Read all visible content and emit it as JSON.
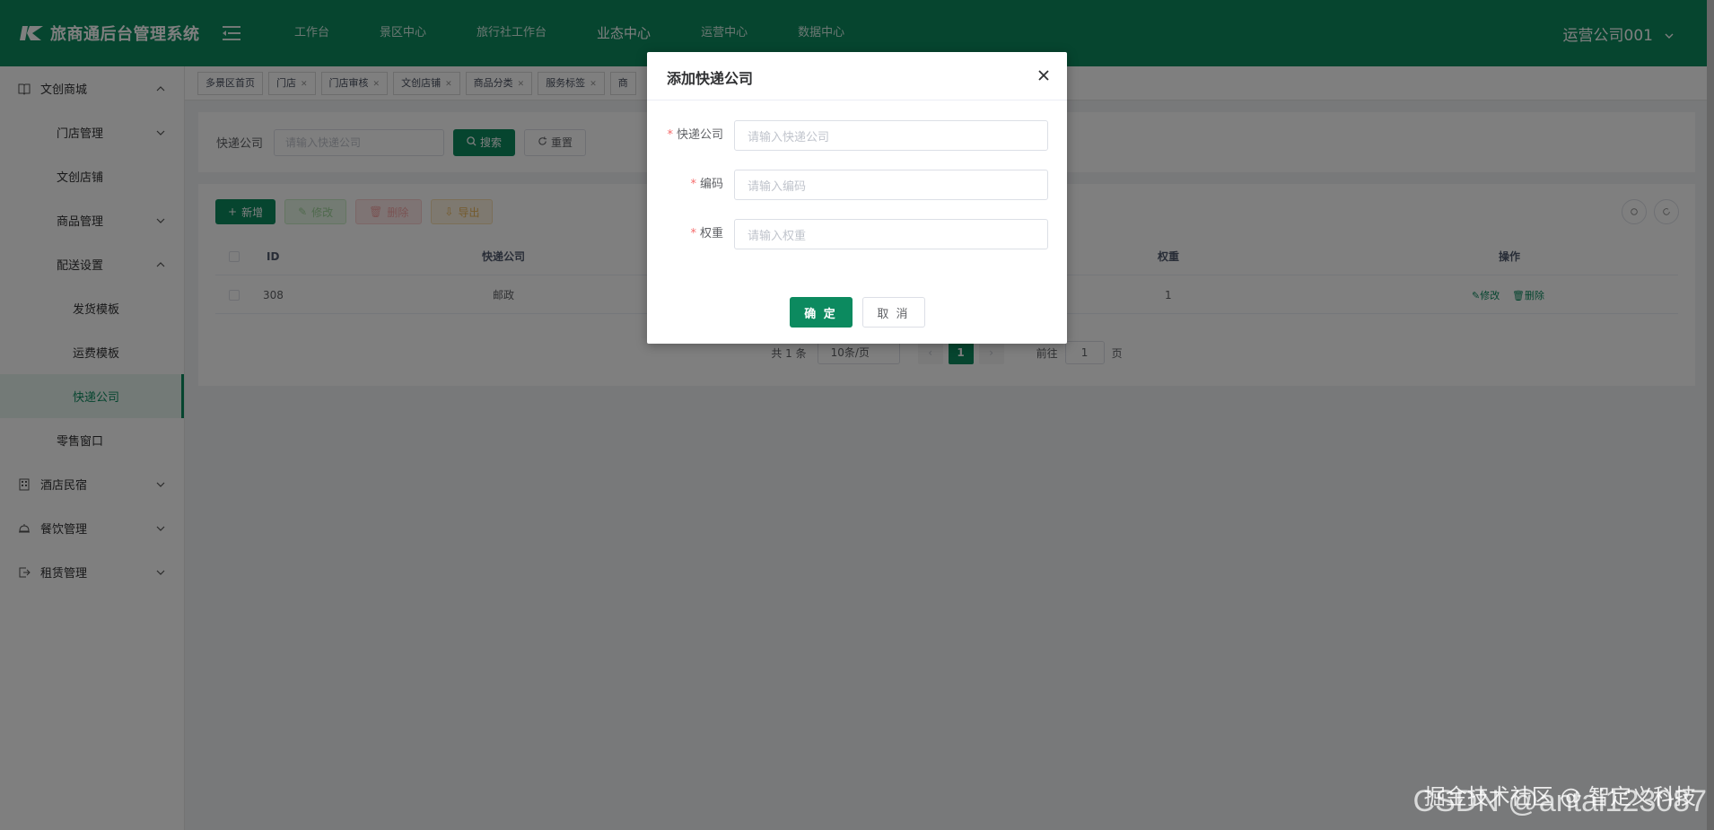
{
  "header": {
    "title": "旅商通后台管理系统",
    "nav": [
      "工作台",
      "景区中心",
      "旅行社工作台",
      "业态中心",
      "运营中心",
      "数据中心"
    ],
    "active_nav": "业态中心",
    "user": "运营公司001"
  },
  "sidebar": {
    "items": [
      {
        "label": "文创商城",
        "icon": "book-icon",
        "level": 1,
        "expanded": true
      },
      {
        "label": "门店管理",
        "level": 2,
        "expandable": true
      },
      {
        "label": "文创店铺",
        "level": 2
      },
      {
        "label": "商品管理",
        "level": 2,
        "expandable": true
      },
      {
        "label": "配送设置",
        "level": 2,
        "expanded": true
      },
      {
        "label": "发货模板",
        "level": 3
      },
      {
        "label": "运费模板",
        "level": 3
      },
      {
        "label": "快递公司",
        "level": 3,
        "active": true
      },
      {
        "label": "零售窗口",
        "level": 2
      },
      {
        "label": "酒店民宿",
        "icon": "building-icon",
        "level": 1,
        "expandable": true
      },
      {
        "label": "餐饮管理",
        "icon": "bell-icon",
        "level": 1,
        "expandable": true
      },
      {
        "label": "租赁管理",
        "icon": "exit-icon",
        "level": 1,
        "expandable": true
      }
    ]
  },
  "tags": [
    "多景区首页",
    "门店",
    "门店审核",
    "文创店铺",
    "商品分类",
    "服务标签",
    "商"
  ],
  "search": {
    "label": "快递公司",
    "placeholder": "请输入快递公司",
    "search_btn": "搜索",
    "reset_btn": "重置"
  },
  "toolbar": {
    "add": "新增",
    "edit": "修改",
    "delete": "删除",
    "export": "导出"
  },
  "table": {
    "headers": [
      "ID",
      "快递公司",
      "权重",
      "操作"
    ],
    "rows": [
      {
        "id": "308",
        "company": "邮政",
        "weight": "1",
        "edit": "修改",
        "delete": "删除"
      }
    ]
  },
  "pager": {
    "total": "共 1 条",
    "size": "10条/页",
    "page": "1",
    "goto_label": "前往",
    "goto_value": "1",
    "page_unit": "页"
  },
  "dialog": {
    "title": "添加快递公司",
    "fields": [
      {
        "label": "快递公司",
        "placeholder": "请输入快递公司"
      },
      {
        "label": "编码",
        "placeholder": "请输入编码"
      },
      {
        "label": "权重",
        "placeholder": "请输入权重"
      }
    ],
    "ok": "确 定",
    "cancel": "取 消"
  },
  "watermark": {
    "line1": "CSDN @antai123087",
    "line2": "掘金技术社区 @ 智定义科技"
  },
  "colors": {
    "primary": "#0c8a5f",
    "danger": "#f56c6c"
  }
}
